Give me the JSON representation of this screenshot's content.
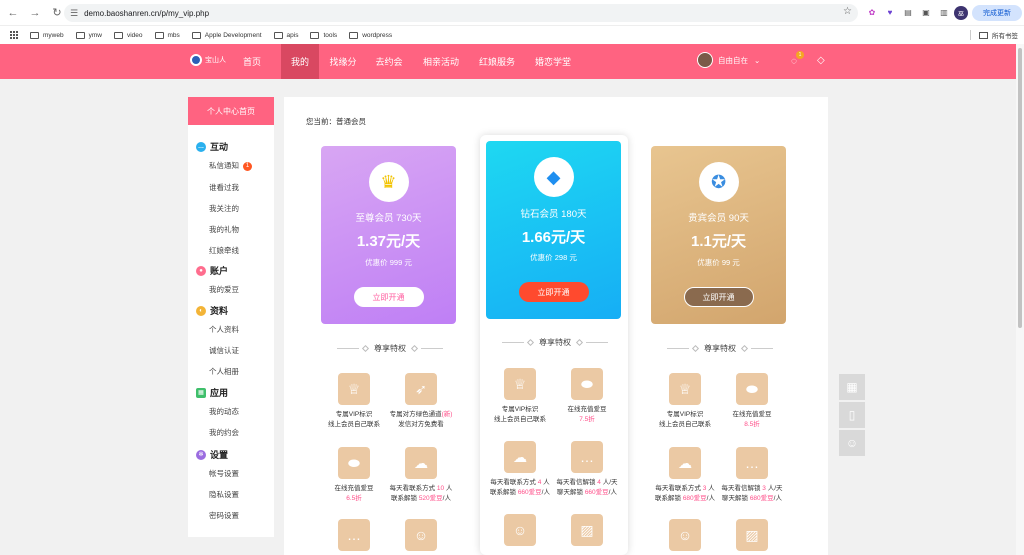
{
  "browser": {
    "url": "demo.baoshanren.cn/p/my_vip.php",
    "update_label": "完成更新",
    "profile_initials": "巫",
    "bookmarks": [
      "myweb",
      "ymw",
      "video",
      "mbs",
      "Apple Development",
      "apis",
      "tools",
      "wordpress"
    ],
    "all_bookmarks": "所有书签"
  },
  "site": {
    "logo_text": "宝山人",
    "nav": [
      "首页",
      "我的",
      "找缘分",
      "去约会",
      "相亲活动",
      "红娘服务",
      "婚恋学堂"
    ],
    "active_nav": "我的",
    "username": "自由自在",
    "notify_count": "1"
  },
  "sidebar": {
    "header": "个人中心首页",
    "sections": [
      {
        "title": "互动",
        "items": [
          "私信通知",
          "谁看过我",
          "我关注的",
          "我的礼物",
          "红娘牵线"
        ],
        "badge": "1"
      },
      {
        "title": "账户",
        "items": [
          "我的爱豆"
        ]
      },
      {
        "title": "资料",
        "items": [
          "个人资料",
          "诚信认证",
          "个人相册"
        ]
      },
      {
        "title": "应用",
        "items": [
          "我的动态",
          "我的约会"
        ]
      },
      {
        "title": "设置",
        "items": [
          "帐号设置",
          "隐私设置",
          "密码设置"
        ]
      }
    ]
  },
  "main": {
    "current_label": "您当前：普通会员",
    "privilege_label": "尊享特权",
    "cards": [
      {
        "name": "至尊会员 730天",
        "price": "1.37元/天",
        "promo": "优惠价 999 元",
        "button": "立即开通",
        "color": "#c98cf5"
      },
      {
        "name": "钻石会员 180天",
        "price": "1.66元/天",
        "promo": "优惠价 298 元",
        "button": "立即开通",
        "color": "#1bc6f3"
      },
      {
        "name": "贵宾会员 90天",
        "price": "1.1元/天",
        "promo": "优惠价 99 元",
        "button": "立即开通",
        "color": "#deb27e"
      }
    ],
    "features_left": [
      {
        "l1": "专属VIP标识",
        "l2": "线上会员自己联系"
      },
      {
        "l1": "专属对方绿色通道",
        "l1b": "(新)",
        "l2": "发信对方免费看"
      },
      {
        "l1": "在线充值爱豆",
        "l2": "6.5折"
      },
      {
        "l1": "每天看联系方式",
        "n1": "10",
        "u1": "人",
        "l2": "联系解锁",
        "n2": "520爱豆",
        "u2": "/人"
      }
    ],
    "features_mid": [
      {
        "l1": "专属VIP标识",
        "l2": "线上会员自己联系"
      },
      {
        "l1": "在线充值爱豆",
        "l2": "7.5折"
      },
      {
        "l1": "每天看联系方式",
        "n1": "4",
        "u1": "人",
        "l2": "联系解锁",
        "n2": "660爱豆",
        "u2": "/人"
      },
      {
        "l1": "每天看信解锁",
        "n1": "4",
        "u1": "人/天",
        "l2": "聊天解锁",
        "n2": "660爱豆",
        "u2": "/人"
      }
    ],
    "features_right": [
      {
        "l1": "专属VIP标识",
        "l2": "线上会员自己联系"
      },
      {
        "l1": "在线充值爱豆",
        "l2": "8.5折"
      },
      {
        "l1": "每天看联系方式",
        "n1": "3",
        "u1": "人",
        "l2": "联系解锁",
        "n2": "680爱豆",
        "u2": "/人"
      },
      {
        "l1": "每天看信解锁",
        "n1": "3",
        "u1": "人/天",
        "l2": "聊天解锁",
        "n2": "680爱豆",
        "u2": "/人"
      }
    ]
  }
}
